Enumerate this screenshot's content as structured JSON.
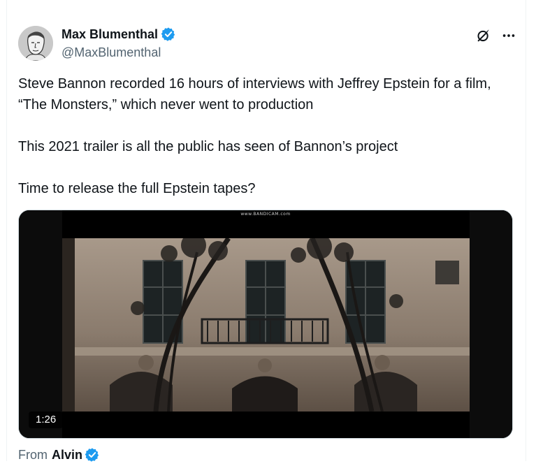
{
  "author": {
    "display_name": "Max Blumenthal",
    "handle": "@MaxBlumenthal",
    "avatar_icon": "sketch-portrait-avatar",
    "verified_icon": "verified-badge-icon",
    "verified_color": "#1d9bf0"
  },
  "actions": {
    "grok_icon": "grok-icon",
    "more_icon": "more-options-icon"
  },
  "tweet": {
    "line1": "Steve Bannon recorded 16 hours of interviews with Jeffrey Epstein for a film, “The Monsters,” which never went to production",
    "line2": "This 2021 trailer is all the public has seen of Bannon’s project",
    "line3": "Time to release the full Epstein tapes?"
  },
  "media": {
    "watermark": "www.BANDICAM.com",
    "duration": "1:26"
  },
  "attribution": {
    "from_label": "From",
    "source_name": "Alvin"
  },
  "colors": {
    "text_primary": "#0f1419",
    "text_secondary": "#536471",
    "accent": "#1d9bf0",
    "border": "#eff3f4"
  }
}
